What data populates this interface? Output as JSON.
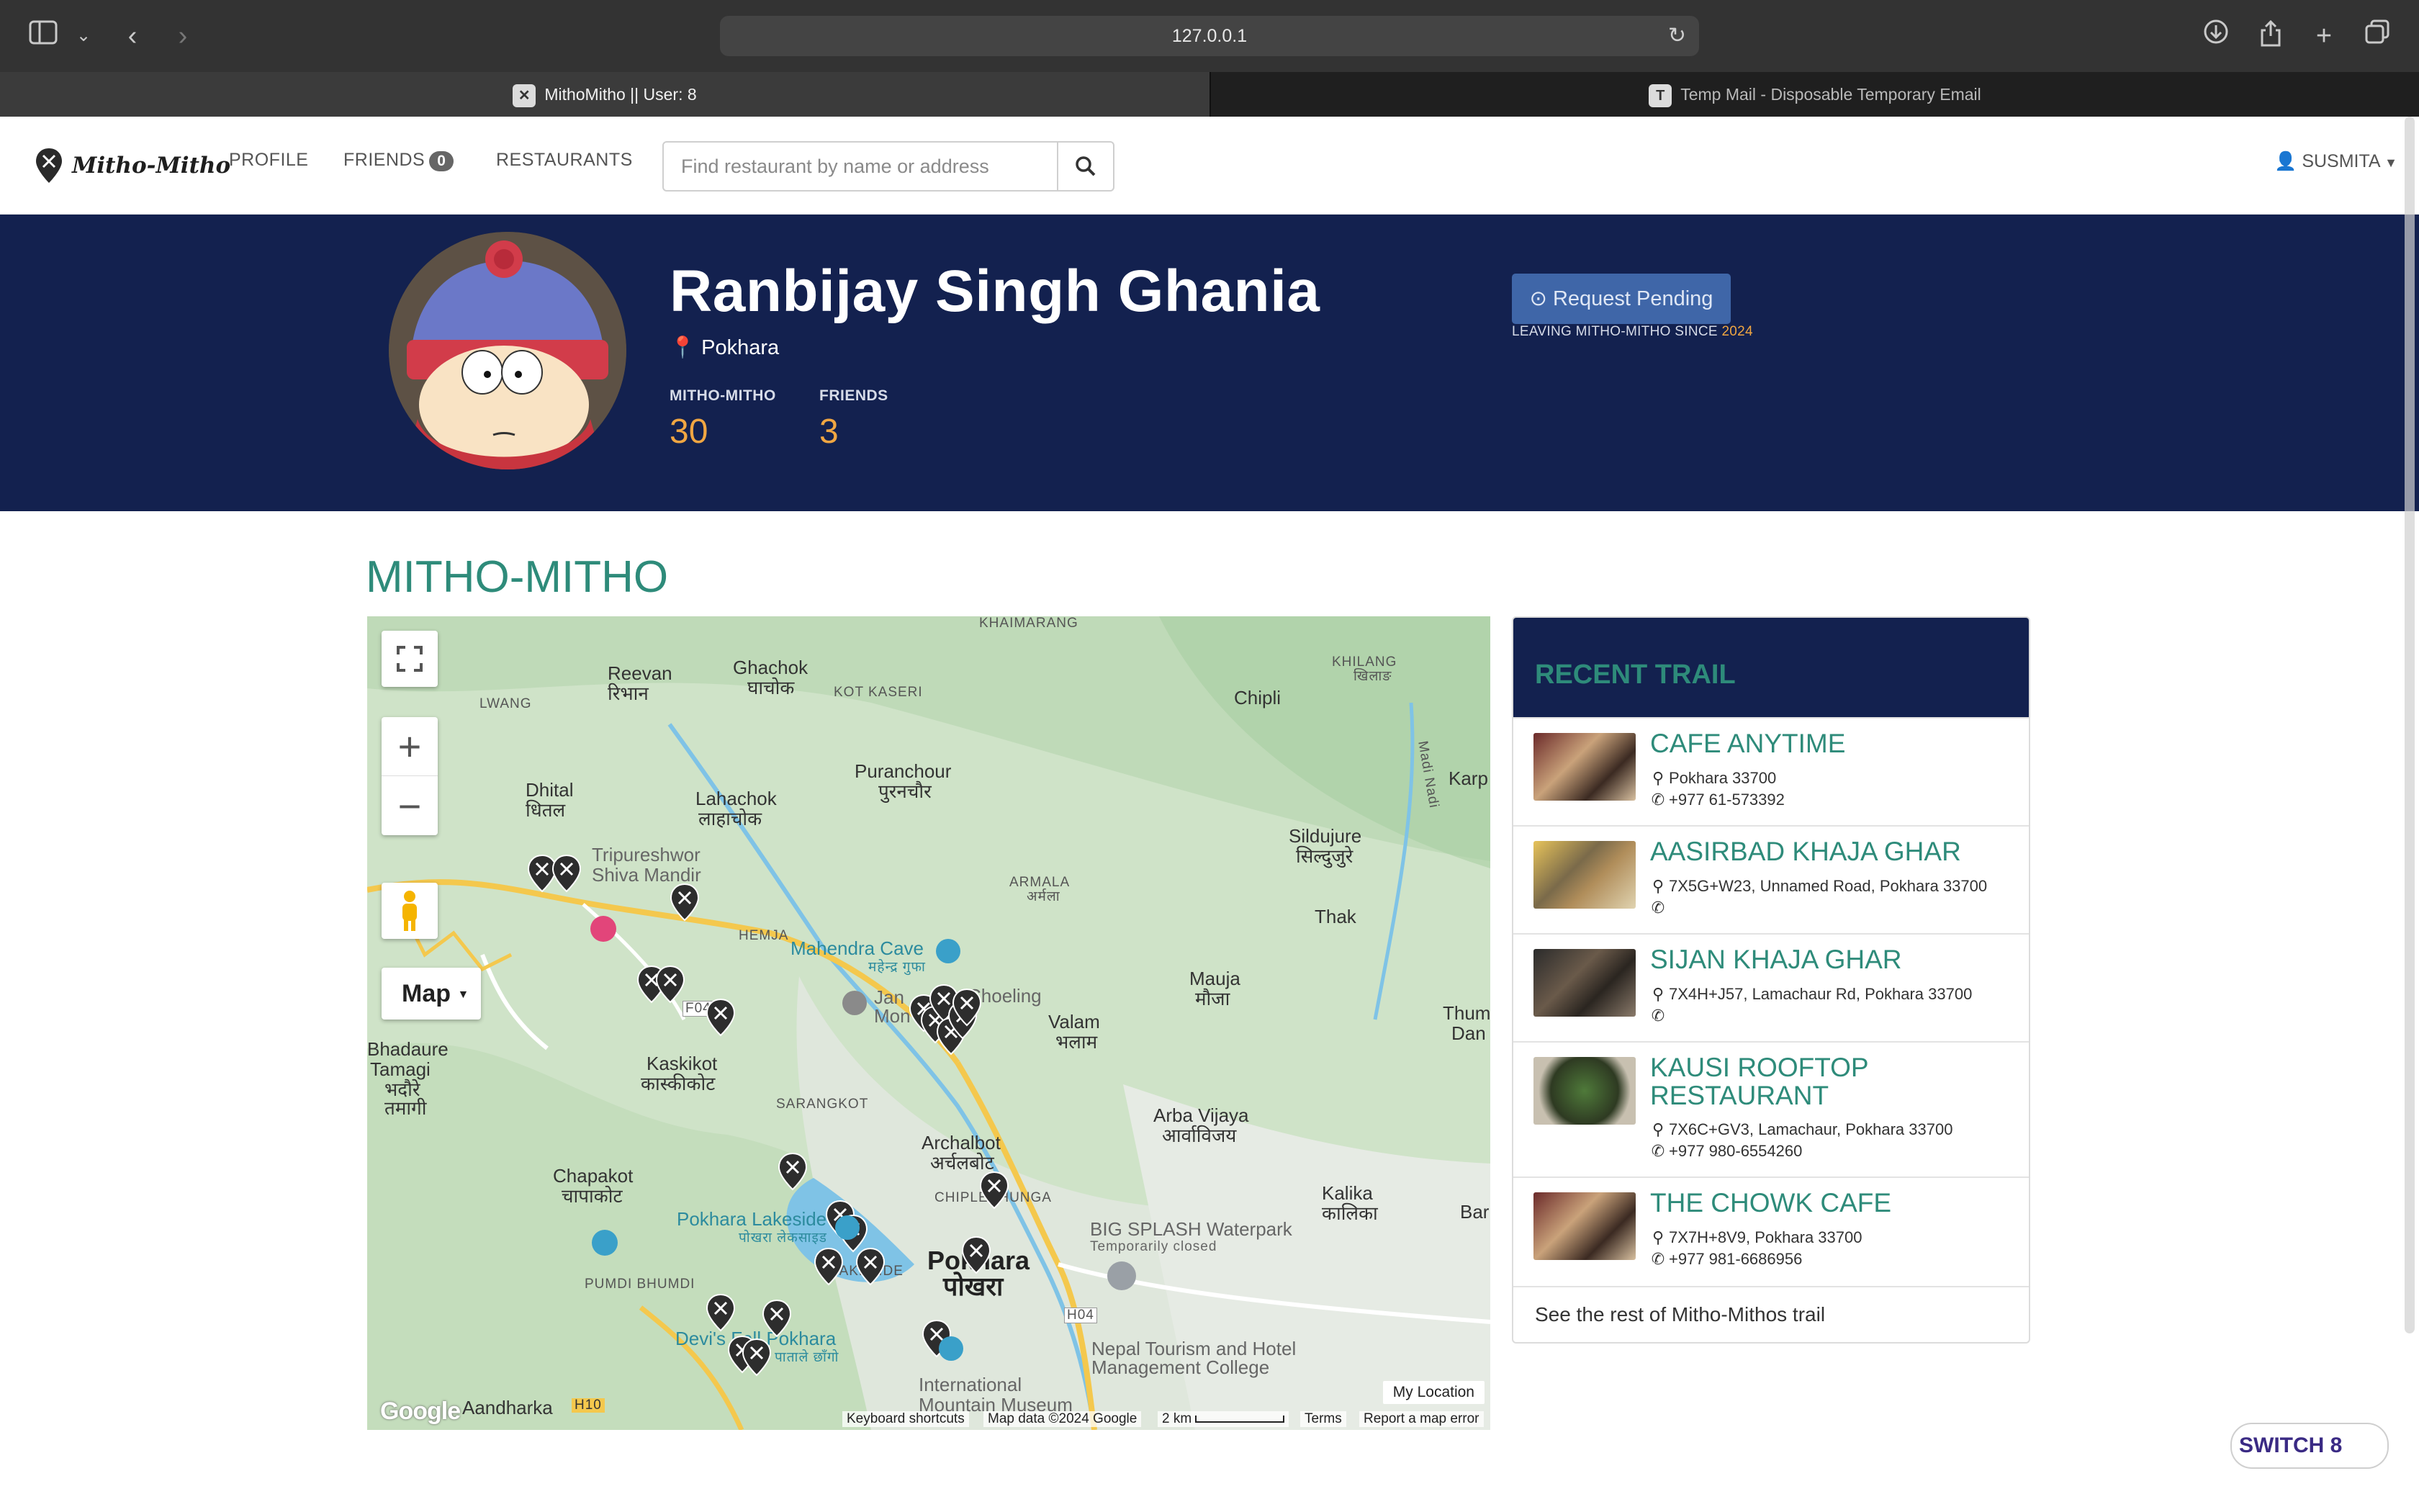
{
  "browser": {
    "url": "127.0.0.1",
    "tabs": [
      {
        "title": "MithoMitho || User: 8",
        "favicon": "mitho-pin-favicon",
        "active": true
      },
      {
        "title": "Temp Mail - Disposable Temporary Email",
        "favicon": "T",
        "active": false
      }
    ]
  },
  "nav": {
    "brand": "Mitho-Mitho",
    "profile": "PROFILE",
    "friends": "FRIENDS",
    "friends_count": "0",
    "restaurants": "RESTAURANTS",
    "search_placeholder": "Find restaurant by name or address",
    "user": "SUSMITA"
  },
  "profile": {
    "name": "Ranbijay Singh Ghania",
    "location": "Pokhara",
    "stats": [
      {
        "label": "MITHO-MITHO",
        "value": "30"
      },
      {
        "label": "FRIENDS",
        "value": "3"
      }
    ],
    "request_button": "Request Pending",
    "since_text": "LEAVING MITHO-MITHO SINCE",
    "since_year": "2024"
  },
  "section": {
    "title": "MITHO-MITHO"
  },
  "map": {
    "type_label": "Map",
    "labels": [
      "KHAIMARANG",
      "KHILANG",
      "खिलाङ",
      "Reevan",
      "रिभान",
      "Ghachok",
      "घाचोक",
      "KOT KASERI",
      "LWANG",
      "Chipli",
      "Puranchour",
      "पुरनचौर",
      "Lahachok",
      "लाहाचोक",
      "Dhital",
      "धितल",
      "Tripureshwor",
      "Shiva Mandir",
      "Sildujure",
      "सिल्दुजुरे",
      "ARMALA",
      "अर्मला",
      "Thak",
      "HEMJA",
      "Mahendra Cave",
      "महेन्द्र गुफा",
      "Choeling",
      "Jan",
      "Mon",
      "Mauja",
      "मौजा",
      "Valam",
      "भलाम",
      "Bhadaure",
      "Tamagi",
      "भदौरे",
      "तमागी",
      "Kaskikot",
      "कास्कीकोट",
      "SARANGKOT",
      "Arba Vijaya",
      "आर्वाविजय",
      "Archalbot",
      "अर्चलबोट",
      "Chapakot",
      "चापाकोट",
      "CHIPLEDHUNGA",
      "Kalika",
      "कालिका",
      "Pokhara Lakeside",
      "पोखरा लेकसाइड",
      "BIG SPLASH Waterpark",
      "Temporarily closed",
      "PUMDI BHUMDI",
      "Pokhara",
      "पोखरा",
      "LAKESIDE",
      "Devi's Fall Pokhara",
      "पाताले छाँगो",
      "Nepal Tourism and Hotel",
      "Management College",
      "International",
      "Mountain Museum",
      "Aandharka",
      "Bar",
      "Thum",
      "Dan",
      "Karp",
      "Madi Nadi",
      "F043",
      "H04",
      "H10"
    ],
    "my_location": "My Location",
    "attribution": {
      "google": "Google",
      "shortcuts": "Keyboard shortcuts",
      "data": "Map data ©2024 Google",
      "scale": "2 km",
      "terms": "Terms",
      "report": "Report a map error"
    },
    "marker_count": 24
  },
  "trail": {
    "title": "RECENT TRAIL",
    "items": [
      {
        "name": "CAFE ANYTIME",
        "address": "Pokhara 33700",
        "phone": "+977 61-573392"
      },
      {
        "name": "AASIRBAD KHAJA GHAR",
        "address": "7X5G+W23, Unnamed Road, Pokhara 33700",
        "phone": ""
      },
      {
        "name": "SIJAN KHAJA GHAR",
        "address": "7X4H+J57, Lamachaur Rd, Pokhara 33700",
        "phone": ""
      },
      {
        "name": "KAUSI ROOFTOP RESTAURANT",
        "address": "7X6C+GV3, Lamachaur, Pokhara 33700",
        "phone": "+977 980-6554260"
      },
      {
        "name": "THE CHOWK CAFE",
        "address": "7X7H+8V9, Pokhara 33700",
        "phone": "+977 981-6686956"
      }
    ],
    "footer": "See the rest of Mitho-Mithos trail"
  },
  "switch_widget": {
    "label": "SWITCH 8"
  },
  "colors": {
    "banner": "#13214f",
    "accent_teal": "#2e8b7a",
    "accent_orange": "#f0a642",
    "button_blue": "#3f66a8"
  }
}
